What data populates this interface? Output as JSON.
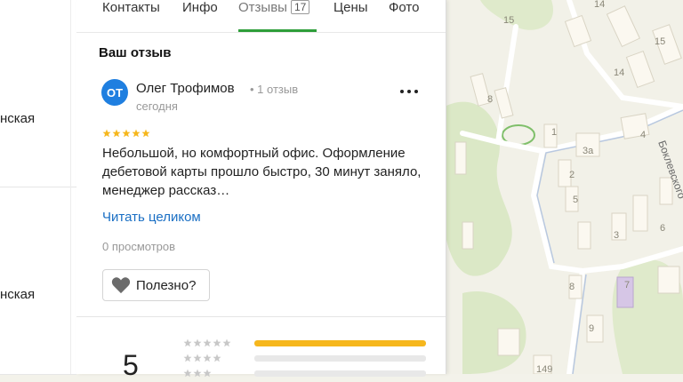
{
  "left_list": {
    "items": [
      {
        "fragment": "нская"
      },
      {
        "fragment": "нская"
      }
    ]
  },
  "tabs": [
    {
      "label": "Контакты"
    },
    {
      "label": "Инфо"
    },
    {
      "label": "Отзывы",
      "badge": "17",
      "active": true
    },
    {
      "label": "Цены"
    },
    {
      "label": "Фото"
    }
  ],
  "review": {
    "section_title": "Ваш отзыв",
    "avatar_initials": "ОТ",
    "avatar_color": "#1f7fe0",
    "author_name": "Олег Трофимов",
    "author_meta": "• 1 отзыв",
    "date": "сегодня",
    "rating_stars": 5,
    "text": "Небольшой, но комфортный офис. Оформление дебетовой карты прошло быстро, 30 минут заняло, менеджер рассказ…",
    "read_more": "Читать целиком",
    "views": "0 просмотров",
    "useful_label": "Полезно?"
  },
  "rating_summary": {
    "score": "5",
    "distribution": [
      {
        "stars": 5,
        "fraction": 1.0
      },
      {
        "stars": 4,
        "fraction": 0.0
      },
      {
        "stars": 3,
        "fraction": 0.0
      }
    ],
    "star_color": "#f6b71d"
  },
  "map": {
    "street_label": "Боклевского",
    "house_numbers": [
      "15",
      "14",
      "8",
      "1",
      "3а",
      "2",
      "5",
      "3",
      "4",
      "8",
      "7",
      "9",
      "149",
      "6"
    ]
  }
}
